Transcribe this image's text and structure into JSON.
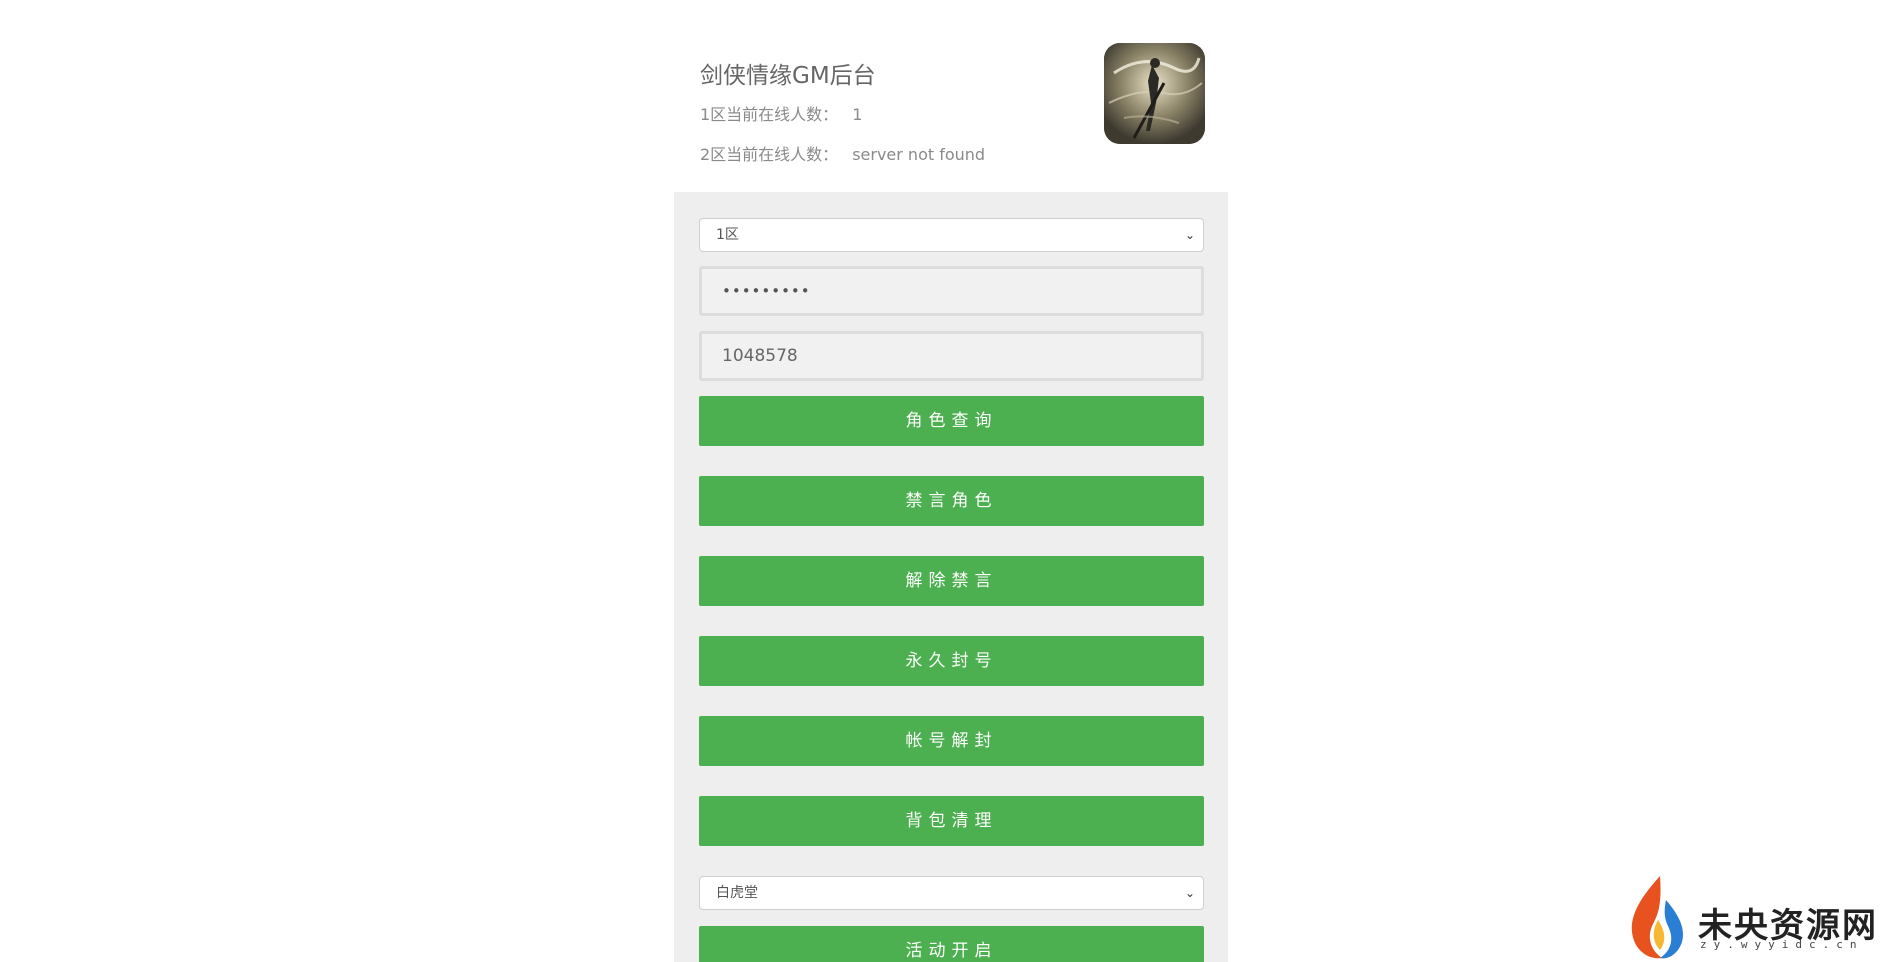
{
  "header": {
    "title": "剑侠情缘GM后台",
    "zone1_label": "1区当前在线人数：",
    "zone1_value": "1",
    "zone2_label": "2区当前在线人数：",
    "zone2_value": "server not found",
    "game_icon": "game-logo-icon"
  },
  "form": {
    "zone_select": {
      "selected": "1区"
    },
    "password_field": {
      "value": "•••••••••"
    },
    "role_id_field": {
      "value": "1048578"
    },
    "buttons": {
      "query_role": "角色查询",
      "mute_role": "禁言角色",
      "unmute": "解除禁言",
      "permanent_ban": "永久封号",
      "account_unban": "帐号解封",
      "clear_bag": "背包清理",
      "activity_open": "活动开启"
    },
    "activity_select": {
      "selected": "白虎堂"
    }
  },
  "colors": {
    "button_green": "#4caf50",
    "panel_bg": "#eeeeee"
  },
  "watermark": {
    "title": "未央资源网",
    "subtitle": "zy.wyyidc.cn",
    "icon": "flame-logo-icon"
  }
}
